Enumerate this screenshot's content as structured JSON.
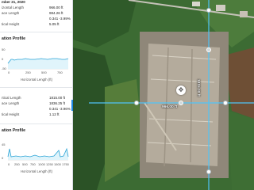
{
  "panel": {
    "date": "mber 21, 2020",
    "top_stats": [
      {
        "label": "izontal Length",
        "value": "966.00 ft"
      },
      {
        "label": "ace Length",
        "value": "984.26 ft"
      },
      {
        "label": "",
        "value": "0.341 -3.99%"
      },
      {
        "label": "tical Height",
        "value": "5.05 ft"
      }
    ],
    "profile1": {
      "title": "ation Profile",
      "y_ticks": [
        "50",
        "0",
        "-50"
      ],
      "x_ticks": [
        "0",
        "250",
        "500",
        "750"
      ],
      "xlabel": "Horizontal Length (ft)"
    },
    "bottom_stats": [
      {
        "label": "rtical Length",
        "value": "1815.00 ft"
      },
      {
        "label": "ace Length",
        "value": "1836.25 ft"
      },
      {
        "label": "",
        "value": "0.341 -3.96%"
      },
      {
        "label": "tical Height",
        "value": "1.12 ft"
      }
    ],
    "profile2": {
      "title": "ation Profile",
      "y_ticks": [
        "45",
        "0"
      ],
      "x_ticks": [
        "0",
        "250",
        "500",
        "750",
        "1000",
        "1250",
        "1500",
        "1750"
      ],
      "xlabel": "Horizontal Length (ft)"
    },
    "collapse_arrow": "‹"
  },
  "map": {
    "horizontal_label": "966.00 ft",
    "vertical_label": "1815.00 ft",
    "move_icon": "✥",
    "accent": "#4fc3f7"
  }
}
